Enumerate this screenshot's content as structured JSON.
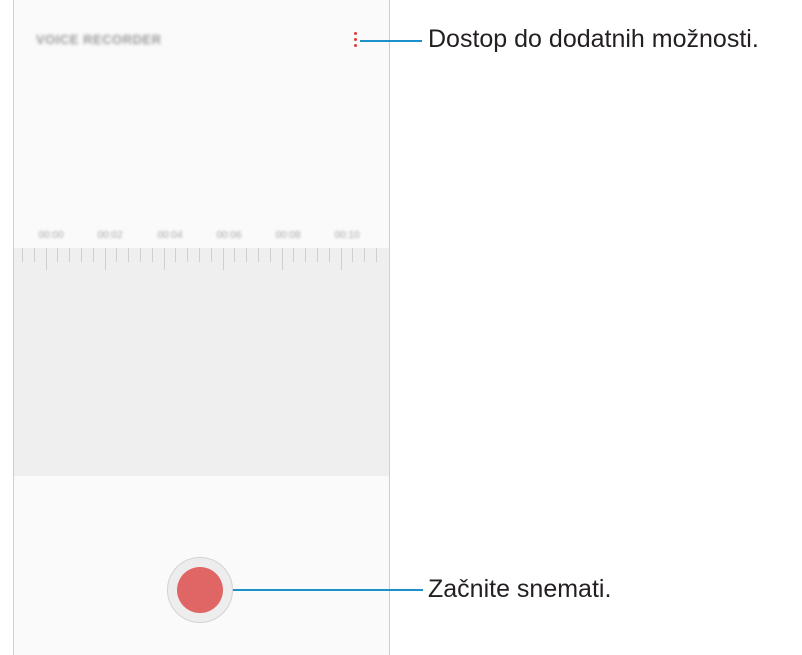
{
  "app": {
    "title": "VOICE RECORDER"
  },
  "timeline": {
    "labels": [
      "00:00",
      "00:02",
      "00:04",
      "00:06",
      "00:08",
      "00:10"
    ]
  },
  "colors": {
    "more_icon": "#e03a3a",
    "record_button": "#e06666",
    "callout_line": "#1d8fc9",
    "timeline_bg": "#efefef"
  },
  "callouts": {
    "more_options": "Dostop do dodatnih možnosti.",
    "start_recording": "Začnite snemati."
  }
}
